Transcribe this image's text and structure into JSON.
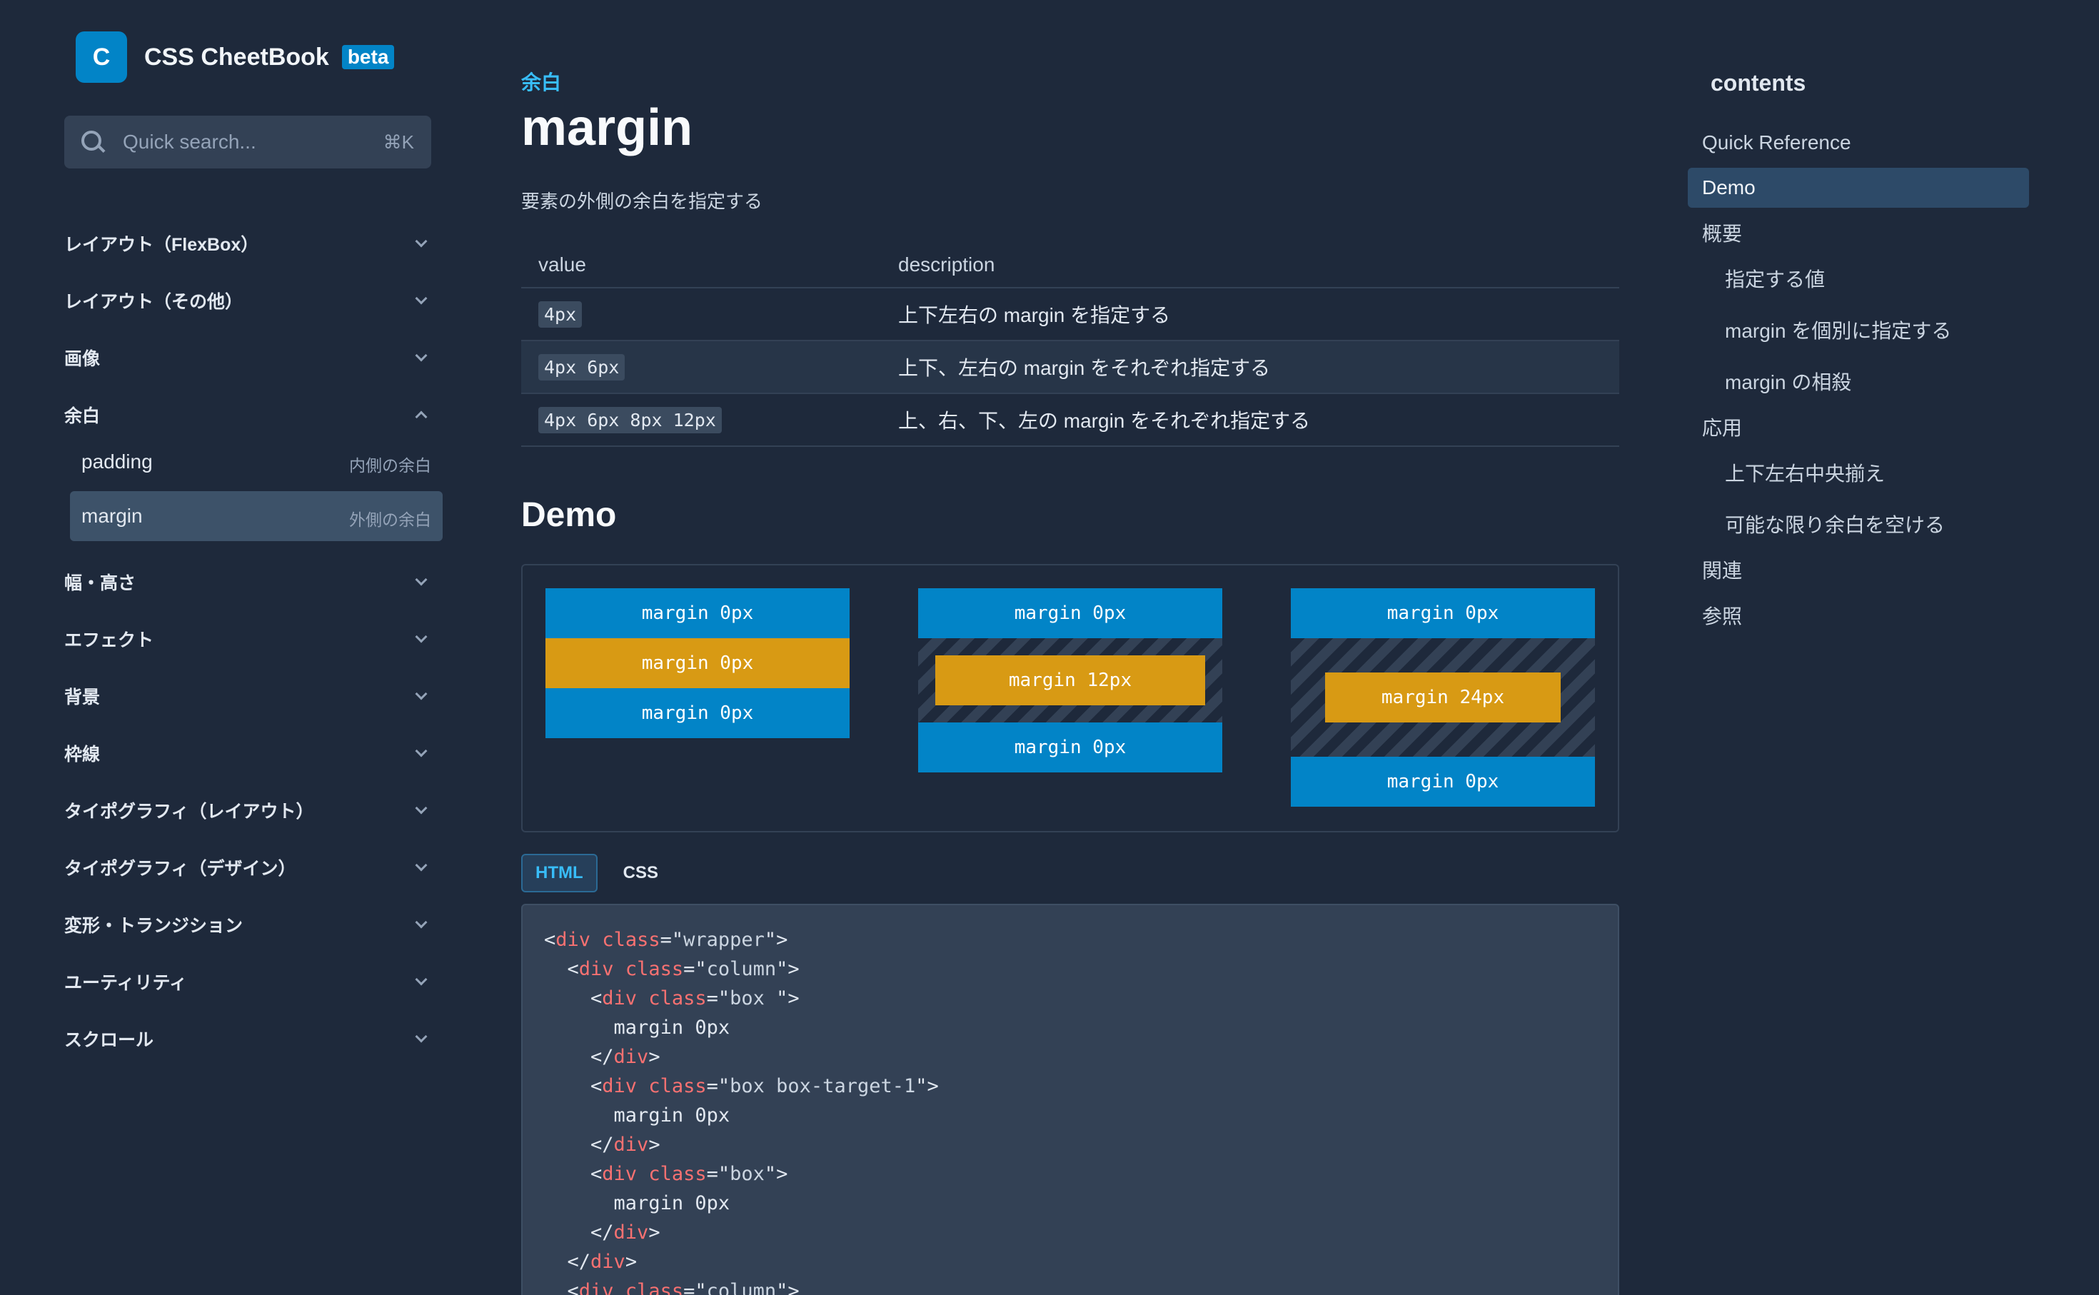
{
  "brand": {
    "logo_letter": "C",
    "name": "CSS CheetBook",
    "badge": "beta"
  },
  "search": {
    "placeholder": "Quick search...",
    "shortcut": "⌘K"
  },
  "nav": {
    "groups": [
      {
        "label": "レイアウト（FlexBox）",
        "expanded": false
      },
      {
        "label": "レイアウト（その他）",
        "expanded": false
      },
      {
        "label": "画像",
        "expanded": false
      },
      {
        "label": "余白",
        "expanded": true
      },
      {
        "label": "幅・高さ",
        "expanded": false
      },
      {
        "label": "エフェクト",
        "expanded": false
      },
      {
        "label": "背景",
        "expanded": false
      },
      {
        "label": "枠線",
        "expanded": false
      },
      {
        "label": "タイポグラフィ（レイアウト）",
        "expanded": false
      },
      {
        "label": "タイポグラフィ（デザイン）",
        "expanded": false
      },
      {
        "label": "変形・トランジション",
        "expanded": false
      },
      {
        "label": "ユーティリティ",
        "expanded": false
      },
      {
        "label": "スクロール",
        "expanded": false
      }
    ],
    "subitems": [
      {
        "label": "padding",
        "hint": "内側の余白",
        "active": false
      },
      {
        "label": "margin",
        "hint": "外側の余白",
        "active": true
      }
    ]
  },
  "main": {
    "eyebrow": "余白",
    "title": "margin",
    "description": "要素の外側の余白を指定する",
    "table": {
      "headers": [
        "value",
        "description"
      ],
      "rows": [
        {
          "value": "4px",
          "description": "上下左右の margin を指定する"
        },
        {
          "value": "4px 6px",
          "description": "上下、左右の margin をそれぞれ指定する"
        },
        {
          "value": "4px 6px 8px 12px",
          "description": "上、右、下、左の margin をそれぞれ指定する"
        }
      ]
    },
    "demo_title": "Demo",
    "demo": {
      "columns": [
        {
          "top": "margin 0px",
          "middle": "margin 0px",
          "bottom": "margin 0px"
        },
        {
          "top": "margin 0px",
          "middle": "margin 12px",
          "bottom": "margin 0px"
        },
        {
          "top": "margin 0px",
          "middle": "margin 24px",
          "bottom": "margin 0px"
        }
      ]
    },
    "tabs": {
      "html": "HTML",
      "css": "CSS",
      "active": "HTML"
    },
    "code_lines": [
      "<div class=\"wrapper\">",
      "  <div class=\"column\">",
      "    <div class=\"box \">",
      "      margin 0px",
      "    </div>",
      "    <div class=\"box box-target-1\">",
      "      margin 0px",
      "    </div>",
      "    <div class=\"box\">",
      "      margin 0px",
      "    </div>",
      "  </div>",
      "  <div class=\"column\">"
    ]
  },
  "toc": {
    "title": "contents",
    "items": [
      {
        "label": "Quick Reference",
        "level": 1,
        "active": false
      },
      {
        "label": "Demo",
        "level": 1,
        "active": true
      },
      {
        "label": "概要",
        "level": 1,
        "active": false
      },
      {
        "label": "指定する値",
        "level": 2,
        "active": false
      },
      {
        "label": "margin を個別に指定する",
        "level": 2,
        "active": false
      },
      {
        "label": "margin の相殺",
        "level": 2,
        "active": false
      },
      {
        "label": "応用",
        "level": 1,
        "active": false
      },
      {
        "label": "上下左右中央揃え",
        "level": 2,
        "active": false
      },
      {
        "label": "可能な限り余白を空ける",
        "level": 2,
        "active": false
      },
      {
        "label": "関連",
        "level": 1,
        "active": false
      },
      {
        "label": "参照",
        "level": 1,
        "active": false
      }
    ]
  },
  "colors": {
    "background": "#1e293b",
    "accent": "#0284c7",
    "accent_text": "#38bdf8",
    "demo_highlight": "#d89a14",
    "code_tag": "#f87171"
  }
}
